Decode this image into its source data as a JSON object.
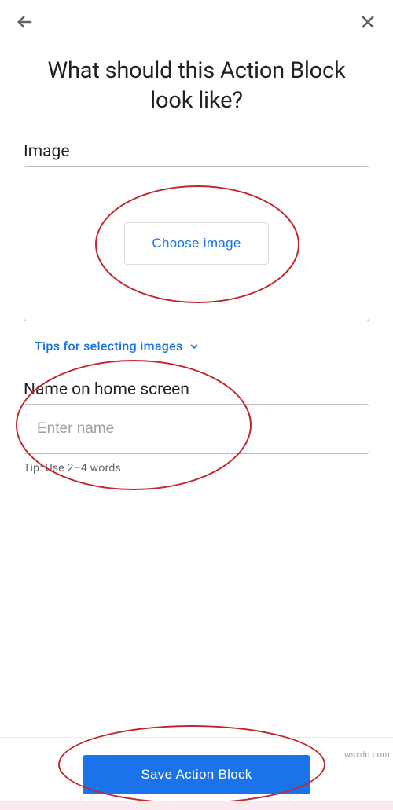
{
  "header": {
    "title": "What should this Action Block look like?"
  },
  "image_section": {
    "label": "Image",
    "choose_button": "Choose image",
    "tips_link": "Tips for selecting images"
  },
  "name_section": {
    "label": "Name on home screen",
    "placeholder": "Enter name",
    "tip": "Tip: Use 2–4 words"
  },
  "footer": {
    "save_button": "Save Action Block"
  },
  "watermark": "wsxdn.com"
}
